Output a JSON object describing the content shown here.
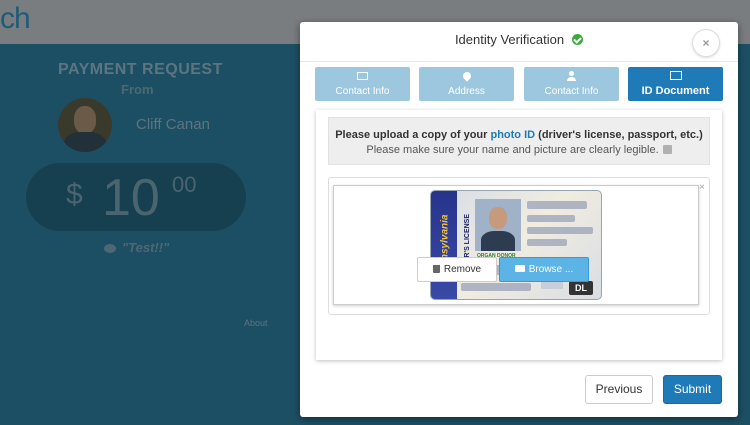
{
  "background": {
    "logo_text": "ch",
    "title": "PAYMENT REQUEST",
    "from_label": "From",
    "sender_name": "Cliff Canan",
    "currency_symbol": "$",
    "amount_whole": "10",
    "amount_cents": "00",
    "memo": "\"Test!!\"",
    "footer_link": "About"
  },
  "modal": {
    "title": "Identity Verification",
    "close_label": "×",
    "tabs": [
      {
        "label": "Contact Info",
        "icon": "envelope-icon"
      },
      {
        "label": "Address",
        "icon": "map-marker-icon"
      },
      {
        "label": "Contact Info",
        "icon": "user-icon"
      },
      {
        "label": "ID Document",
        "icon": "picture-icon",
        "active": true
      }
    ],
    "instructions": {
      "prefix": "Please upload a copy of your ",
      "link": "photo ID",
      "suffix": " (driver's license, passport, etc.)",
      "line2": "Please make sure your name and picture are clearly legible."
    },
    "preview": {
      "close_label": "×",
      "license_state": "Pennsylvania",
      "license_type": "DRIVER'S LICENSE",
      "donor_label": "ORGAN DONOR",
      "class_label": "DL"
    },
    "remove_label": "Remove",
    "browse_label": "Browse ...",
    "previous_label": "Previous",
    "submit_label": "Submit"
  },
  "colors": {
    "accent": "#1f7ab8",
    "tab_inactive": "#9dc7df",
    "browse": "#5bb3e6",
    "success": "#3ba93e"
  }
}
